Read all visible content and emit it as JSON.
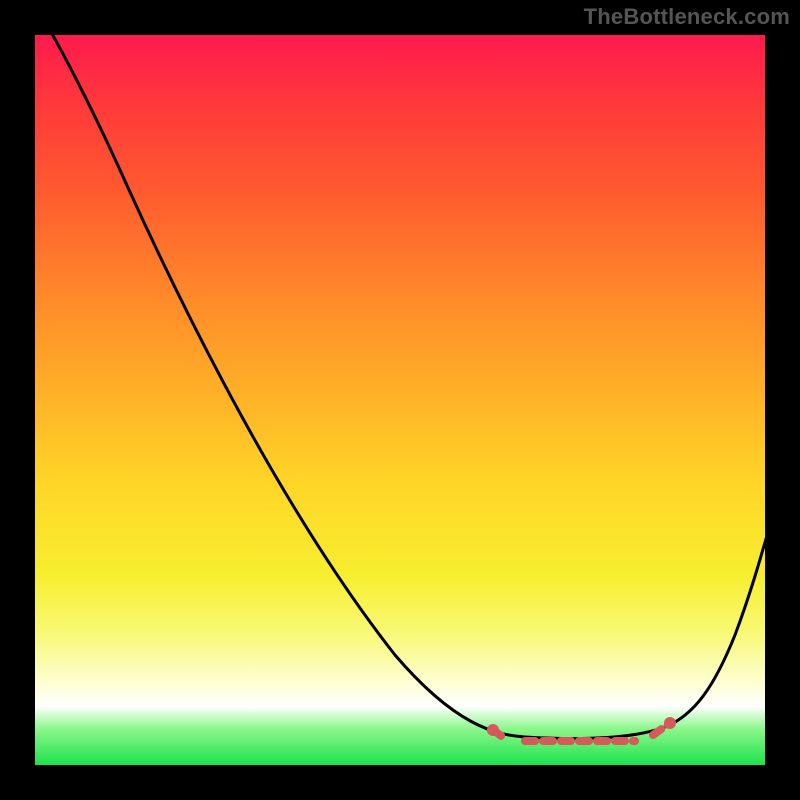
{
  "watermark": "TheBottleneck.com",
  "chart_data": {
    "type": "line",
    "title": "",
    "xlabel": "",
    "ylabel": "",
    "xlim": [
      0,
      100
    ],
    "ylim": [
      0,
      100
    ],
    "series": [
      {
        "name": "bottleneck-curve",
        "x": [
          2,
          12,
          25,
          38,
          50,
          63,
          68,
          75,
          82,
          88,
          95,
          100
        ],
        "y": [
          100,
          82,
          62,
          42,
          25,
          10,
          5,
          3,
          3,
          6,
          18,
          33
        ]
      }
    ],
    "annotations": [
      {
        "name": "optimal-region",
        "x_start": 63,
        "x_end": 88,
        "style": "dashed-red-markers"
      }
    ],
    "background_gradient": {
      "top": "#ff1a4d",
      "mid": "#ffe627",
      "bottom": "#1de24b"
    },
    "frame_color": "#000000"
  }
}
